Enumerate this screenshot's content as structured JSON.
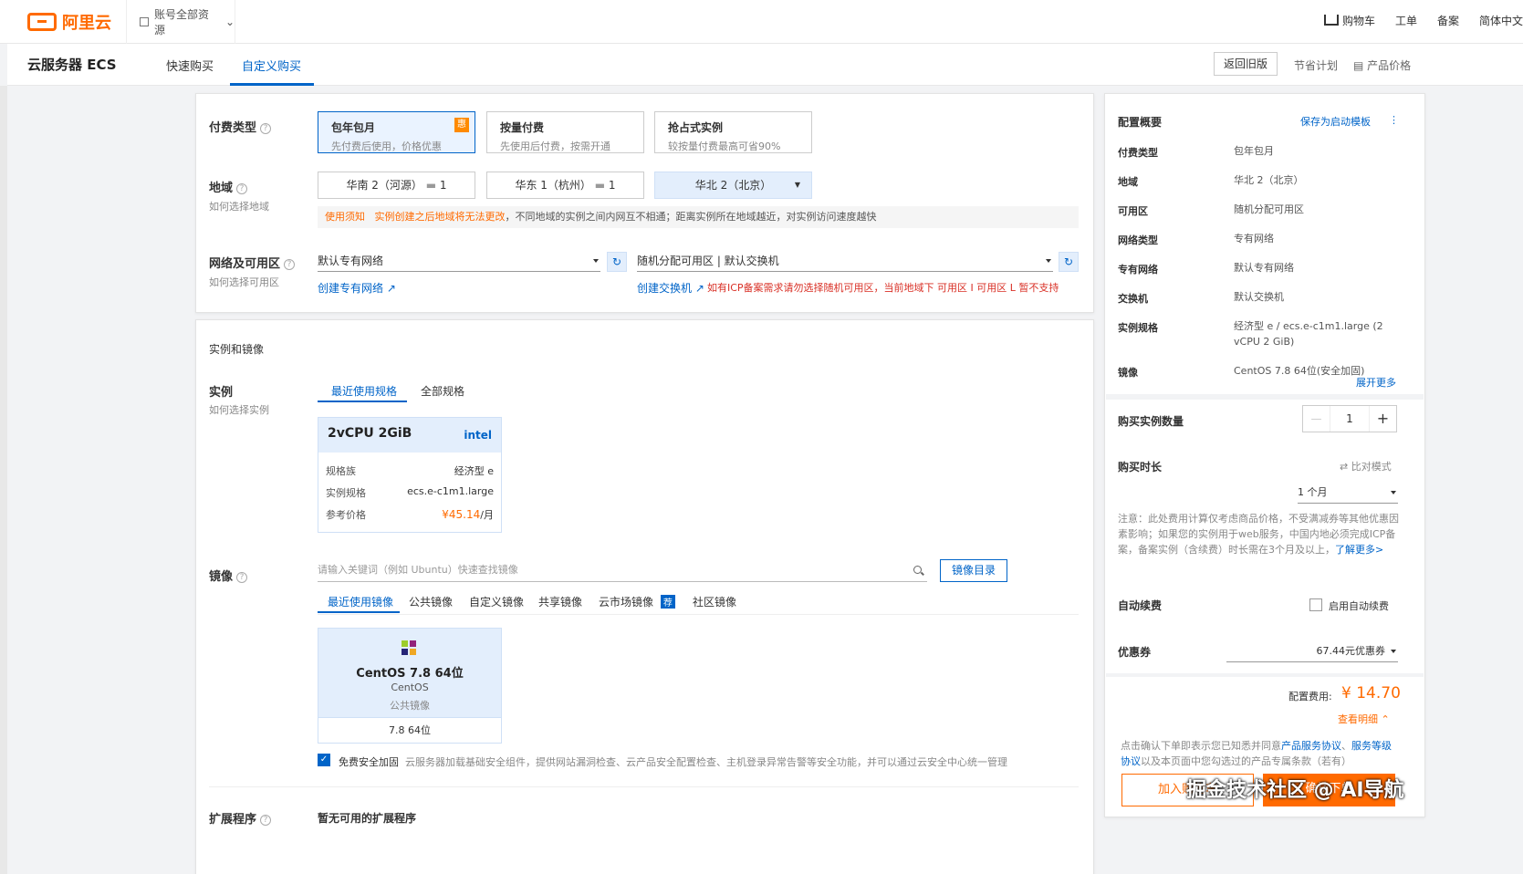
{
  "topbar": {
    "logo_text": "阿里云",
    "resource_selector": "账号全部资源",
    "links": [
      "购物车",
      "工单",
      "备案",
      "简体中文"
    ]
  },
  "subnav": {
    "product_title": "云服务器 ECS",
    "tabs": [
      "快速购买",
      "自定义购买"
    ],
    "old_version_btn": "返回旧版",
    "savings_plan": "节省计划",
    "product_price": "产品价格"
  },
  "billing": {
    "label": "付费类型",
    "options": [
      {
        "title": "包年包月",
        "desc": "先付费后使用，价格优惠",
        "badge": "惠"
      },
      {
        "title": "按量付费",
        "desc": "先使用后付费，按需开通"
      },
      {
        "title": "抢占式实例",
        "desc": "较按量付费最高可省90%"
      }
    ]
  },
  "region": {
    "label": "地域",
    "help": "如何选择地域",
    "options": [
      "华南 2（河源）",
      "华东 1（杭州）",
      "华北 2（北京）"
    ],
    "counts": [
      "1",
      "1"
    ],
    "notice_label": "使用须知",
    "notice_orange": "实例创建之后地域将无法更改",
    "notice_rest": "，不同地域的实例之间内网互不相通；距离实例所在地域越近，对实例访问速度越快"
  },
  "network": {
    "label": "网络及可用区",
    "help": "如何选择可用区",
    "vpc_value": "默认专有网络",
    "zone_value": "随机分配可用区 | 默认交换机",
    "create_vpc": "创建专有网络",
    "create_vswitch": "创建交换机",
    "icp_warning": "如有ICP备案需求请勿选择随机可用区，当前地域下 可用区 I 可用区 L 暂不支持"
  },
  "instance_section": {
    "title": "实例和镜像",
    "instance_label": "实例",
    "instance_help": "如何选择实例",
    "tabs": [
      "最近使用规格",
      "全部规格"
    ],
    "spec": {
      "name": "2vCPU 2GiB",
      "brand": "intel",
      "rows": [
        {
          "k": "规格族",
          "v": "经济型 e"
        },
        {
          "k": "实例规格",
          "v": "ecs.e-c1m1.large"
        },
        {
          "k": "参考价格",
          "v": "¥45.14",
          "unit": "/月"
        }
      ]
    }
  },
  "image": {
    "label": "镜像",
    "search_placeholder": "请输入关键词（例如 Ubuntu）快速查找镜像",
    "catalog_btn": "镜像目录",
    "tabs": [
      "最近使用镜像",
      "公共镜像",
      "自定义镜像",
      "共享镜像",
      "云市场镜像",
      "社区镜像"
    ],
    "market_badge": "荐",
    "selected": {
      "name": "CentOS 7.8 64位",
      "os": "CentOS",
      "type": "公共镜像",
      "version": "7.8 64位"
    },
    "security_label": "免费安全加固",
    "security_desc": "云服务器加载基础安全组件，提供网站漏洞检查、云产品安全配置检查、主机登录异常告警等安全功能，并可以通过云安全中心统一管理"
  },
  "extension": {
    "label": "扩展程序",
    "value": "暂无可用的扩展程序"
  },
  "summary": {
    "title": "配置概要",
    "save_template": "保存为启动模板",
    "rows": [
      {
        "k": "付费类型",
        "v": "包年包月"
      },
      {
        "k": "地域",
        "v": "华北 2（北京）"
      },
      {
        "k": "可用区",
        "v": "随机分配可用区"
      },
      {
        "k": "网络类型",
        "v": "专有网络"
      },
      {
        "k": "专有网络",
        "v": "默认专有网络"
      },
      {
        "k": "交换机",
        "v": "默认交换机"
      },
      {
        "k": "实例规格",
        "v": "经济型 e / ecs.e-c1m1.large (2 vCPU 2 GiB)"
      },
      {
        "k": "镜像",
        "v": "CentOS 7.8 64位(安全加固)"
      }
    ],
    "expand_more": "展开更多",
    "quantity_label": "购买实例数量",
    "quantity_value": "1",
    "duration_label": "购买时长",
    "compare_mode": "比对模式",
    "duration_value": "1 个月",
    "note": "注意：此处费用计算仅考虑商品价格，不受满减券等其他优惠因素影响；如果您的实例用于web服务，中国内地必须完成ICP备案，备案实例（含续费）时长需在3个月及以上，",
    "learn_more": "了解更多>",
    "auto_renew_label": "自动续费",
    "auto_renew_option": "启用自动续费",
    "coupon_label": "优惠券",
    "coupon_value": "67.44元优惠券",
    "fee_label": "配置费用:",
    "fee_value": "¥ 14.70",
    "view_detail": "查看明细",
    "agreement_pre": "点击确认下单即表示您已知悉并同意",
    "agreement_link1": "产品服务协议",
    "agreement_link2": "服务等级协议",
    "agreement_post": "以及本页面中您勾选过的产品专属条款（若有）",
    "add_cart": "加入购物车",
    "confirm": "确认下单"
  },
  "watermark": "掘金技术社区 @ AI导航"
}
